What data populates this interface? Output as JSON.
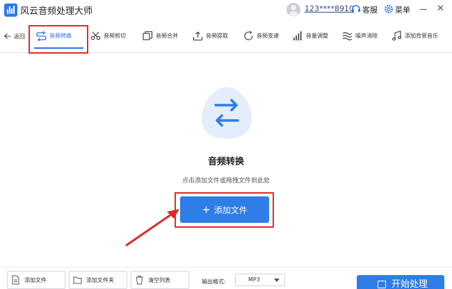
{
  "app": {
    "title": "风云音频处理大师"
  },
  "header": {
    "user_id": "123****8910",
    "service_label": "客服",
    "menu_label": "菜单",
    "close_glyph": "✕"
  },
  "toolbar": {
    "back_label": "返回",
    "tools": [
      {
        "label": "音频转换",
        "icon": "convert-icon",
        "active": true
      },
      {
        "label": "音频剪切",
        "icon": "scissors-icon"
      },
      {
        "label": "音频合并",
        "icon": "merge-icon"
      },
      {
        "label": "音频提取",
        "icon": "extract-icon"
      },
      {
        "label": "音频变速",
        "icon": "speed-icon"
      },
      {
        "label": "音量调整",
        "icon": "volume-bars-icon"
      },
      {
        "label": "噪声消除",
        "icon": "noise-wave-icon"
      },
      {
        "label": "添加背景音乐",
        "icon": "music-note-icon"
      }
    ]
  },
  "main": {
    "title": "音频转换",
    "hint": "点击添加文件或拖拽文件到此处",
    "add_button": "添加文件",
    "add_button_plus": "+"
  },
  "bottom": {
    "add_file": "添加文件",
    "add_folder": "添加文件夹",
    "clear_list": "清空列表",
    "format_label": "输出格式:",
    "format_value": "MP3",
    "start": "开始处理"
  },
  "colors": {
    "accent": "#2f7de6",
    "highlight_box": "#e0292a"
  }
}
